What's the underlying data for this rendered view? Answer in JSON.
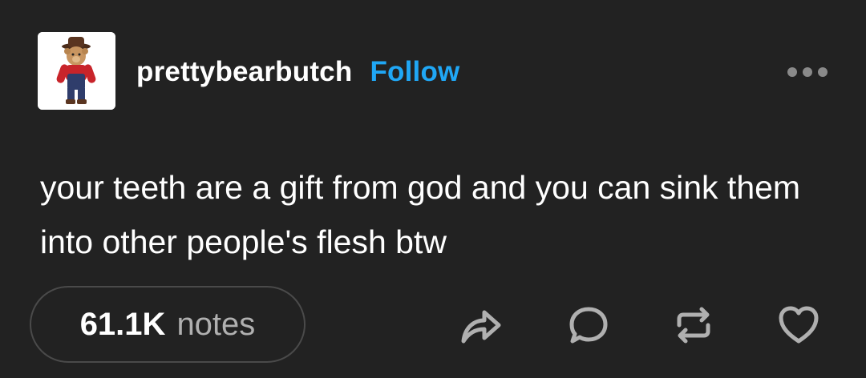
{
  "post": {
    "username": "prettybearbutch",
    "follow_label": "Follow",
    "body": "your teeth are a gift from god and you can sink them into other people's flesh btw",
    "notes_count": "61.1K",
    "notes_label": "notes"
  },
  "icons": {
    "avatar": "teddy-bear-cowboy-avatar",
    "more": "ellipsis-icon",
    "share": "share-icon",
    "reply": "reply-icon",
    "reblog": "reblog-icon",
    "like": "heart-icon"
  },
  "colors": {
    "background": "#222222",
    "text": "#ffffff",
    "follow": "#20a7f5",
    "muted": "#b0b0b0",
    "border": "#4a4a4a"
  }
}
